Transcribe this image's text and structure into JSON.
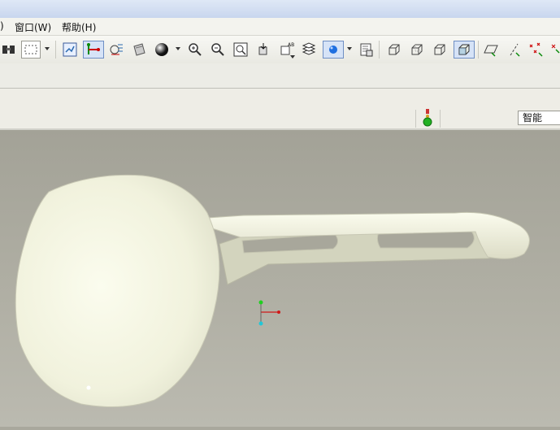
{
  "menu": {
    "partial_label": ")",
    "window_label": "窗口(W)",
    "help_label": "帮助(H)"
  },
  "filter": {
    "value": "智能"
  },
  "toolbar": {
    "icons": [
      "view-manager-icon",
      "box-select-icon",
      "redraw-icon",
      "datum-display-icon",
      "spin-center-icon",
      "appearance-icon",
      "color-sphere-icon",
      "zoom-in-icon",
      "zoom-out-icon",
      "zoom-fit-icon",
      "orient-icon",
      "named-view-icon",
      "layers-icon",
      "display-style-icon",
      "model-tree-icon",
      "wireframe-icon",
      "hidden-line-icon",
      "no-hidden-icon",
      "shaded-icon",
      "datum-plane-icon",
      "datum-axis-icon",
      "datum-point-icon",
      "csys-icon"
    ]
  }
}
